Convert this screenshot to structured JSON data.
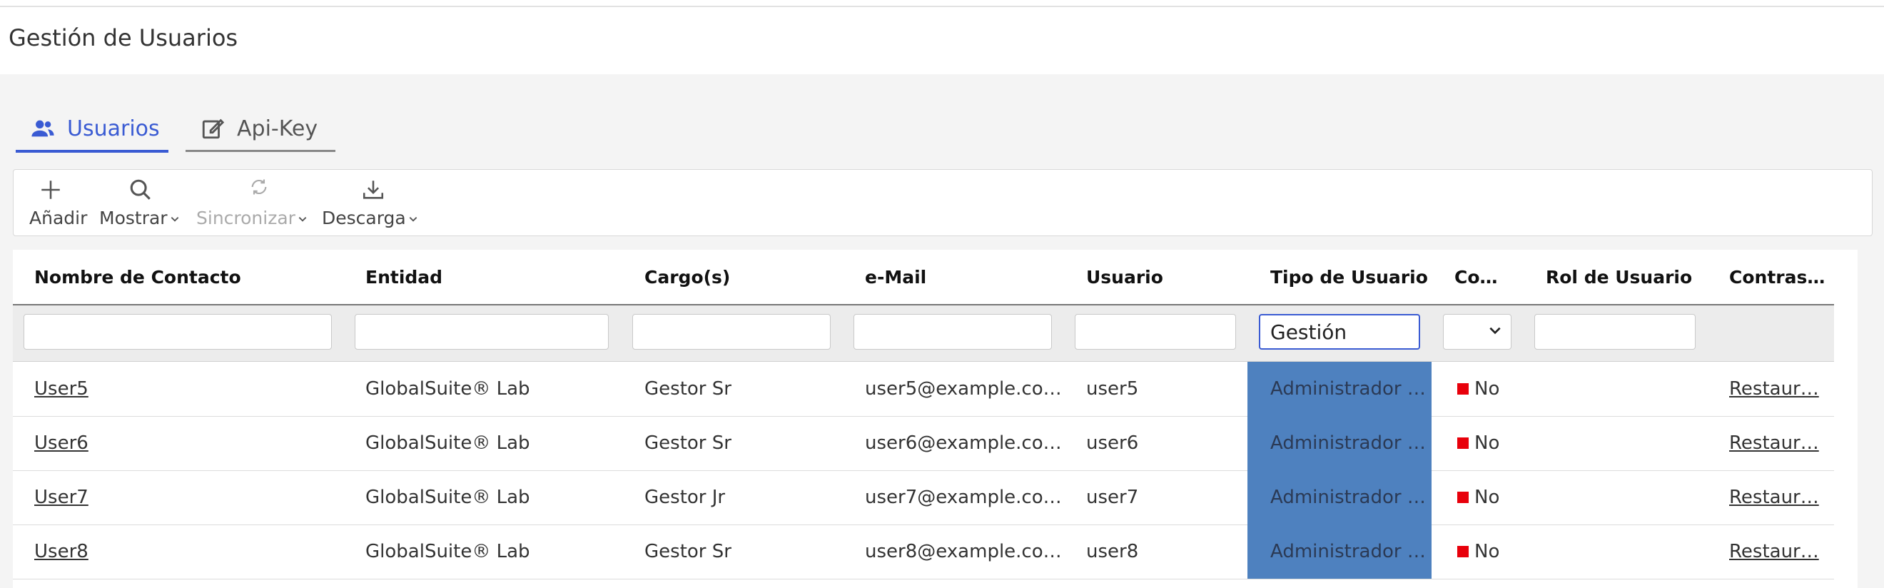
{
  "header": {
    "title": "Gestión de Usuarios"
  },
  "tabs": [
    {
      "label": "Usuarios",
      "icon": "users-icon",
      "active": true
    },
    {
      "label": "Api-Key",
      "icon": "edit-icon",
      "active": false
    }
  ],
  "toolbar": {
    "add_label": "Añadir",
    "show_label": "Mostrar",
    "sync_label": "Sincronizar",
    "download_label": "Descarga"
  },
  "table": {
    "columns": [
      "Nombre de Contacto",
      "Entidad",
      "Cargo(s)",
      "e-Mail",
      "Usuario",
      "Tipo de Usuario",
      "Co…",
      "Rol de Usuario",
      "Contras…"
    ],
    "filters": {
      "tipo_value": "Gestión"
    },
    "rows": [
      {
        "name": "User5",
        "entity": "GlobalSuite® Lab",
        "cargo": "Gestor Sr",
        "email": "user5@example.co…",
        "usuario": "user5",
        "tipo": "Administrador …",
        "co": "No",
        "rol": "",
        "pass": "Restaur…"
      },
      {
        "name": "User6",
        "entity": "GlobalSuite® Lab",
        "cargo": "Gestor Sr",
        "email": "user6@example.co…",
        "usuario": "user6",
        "tipo": "Administrador …",
        "co": "No",
        "rol": "",
        "pass": "Restaur…"
      },
      {
        "name": "User7",
        "entity": "GlobalSuite® Lab",
        "cargo": "Gestor Jr",
        "email": "user7@example.co…",
        "usuario": "user7",
        "tipo": "Administrador …",
        "co": "No",
        "rol": "",
        "pass": "Restaur…"
      },
      {
        "name": "User8",
        "entity": "GlobalSuite® Lab",
        "cargo": "Gestor Sr",
        "email": "user8@example.co…",
        "usuario": "user8",
        "tipo": "Administrador …",
        "co": "No",
        "rol": "",
        "pass": "Restaur…"
      }
    ]
  },
  "colors": {
    "accent": "#3a5bd3",
    "tipo_bg": "#4e81bf",
    "flag": "#e8000b"
  }
}
